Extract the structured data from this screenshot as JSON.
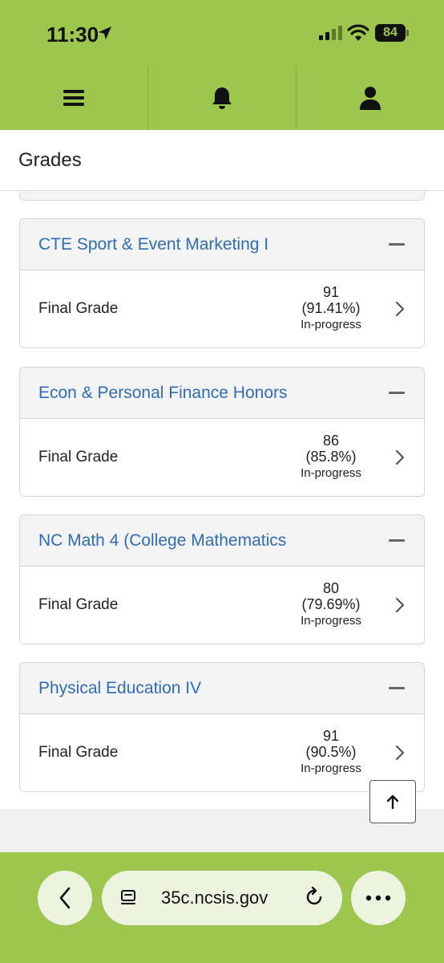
{
  "status": {
    "time": "11:30",
    "battery": "84"
  },
  "page": {
    "title": "Grades"
  },
  "courses": [
    {
      "name": "CTE Sport & Event Marketing I",
      "label": "Final Grade",
      "grade": "91",
      "percent": "(91.41%)",
      "status": "In-progress"
    },
    {
      "name": "Econ & Personal Finance Honors",
      "label": "Final Grade",
      "grade": "86",
      "percent": "(85.8%)",
      "status": "In-progress"
    },
    {
      "name": "NC Math 4 (College Mathematics",
      "label": "Final Grade",
      "grade": "80",
      "percent": "(79.69%)",
      "status": "In-progress"
    },
    {
      "name": "Physical Education IV",
      "label": "Final Grade",
      "grade": "91",
      "percent": "(90.5%)",
      "status": "In-progress"
    }
  ],
  "browser": {
    "url": "35c.ncsis.gov"
  },
  "icons": [
    "location-arrow-icon",
    "signal-icon",
    "wifi-icon",
    "menu-icon",
    "bell-icon",
    "user-icon",
    "minus-icon",
    "chevron-right-icon",
    "arrow-up-icon",
    "chevron-left-icon",
    "reader-icon",
    "reload-icon",
    "more-icon"
  ],
  "colors": {
    "brand_green": "#9dc64f",
    "link_blue": "#2f6db5"
  }
}
